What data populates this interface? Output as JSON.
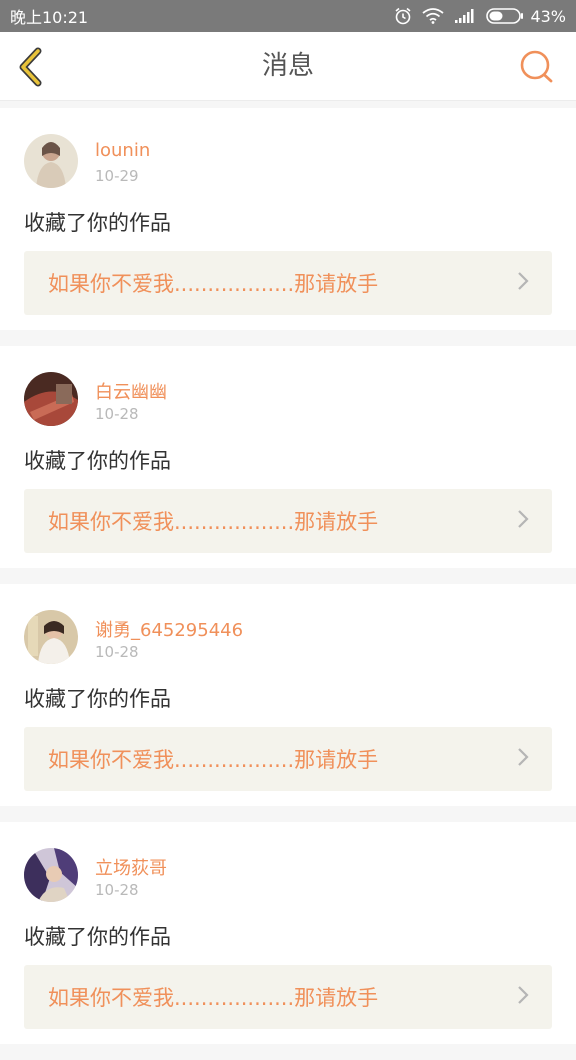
{
  "status_bar": {
    "time": "晚上10:21",
    "battery": "43%",
    "icons": [
      "alarm-icon",
      "wifi-icon",
      "signal-icon",
      "battery-icon"
    ]
  },
  "header": {
    "title": "消息",
    "back_icon": "chevron-left-icon",
    "search_icon": "search-icon"
  },
  "messages": [
    {
      "user": "lounin",
      "date": "10-29",
      "action": "收藏了你的作品",
      "work": "如果你不爱我..................那请放手"
    },
    {
      "user": "白云幽幽",
      "date": "10-28",
      "action": "收藏了你的作品",
      "work": "如果你不爱我..................那请放手"
    },
    {
      "user": "谢勇_645295446",
      "date": "10-28",
      "action": "收藏了你的作品",
      "work": "如果你不爱我..................那请放手"
    },
    {
      "user": "立场荻哥",
      "date": "10-28",
      "action": "收藏了你的作品",
      "work": "如果你不爱我..................那请放手"
    }
  ],
  "colors": {
    "accent": "#f0905a",
    "back_icon": "#e8c33a",
    "status_bar": "#7a7a7a",
    "box_bg": "#f4f3ec"
  }
}
